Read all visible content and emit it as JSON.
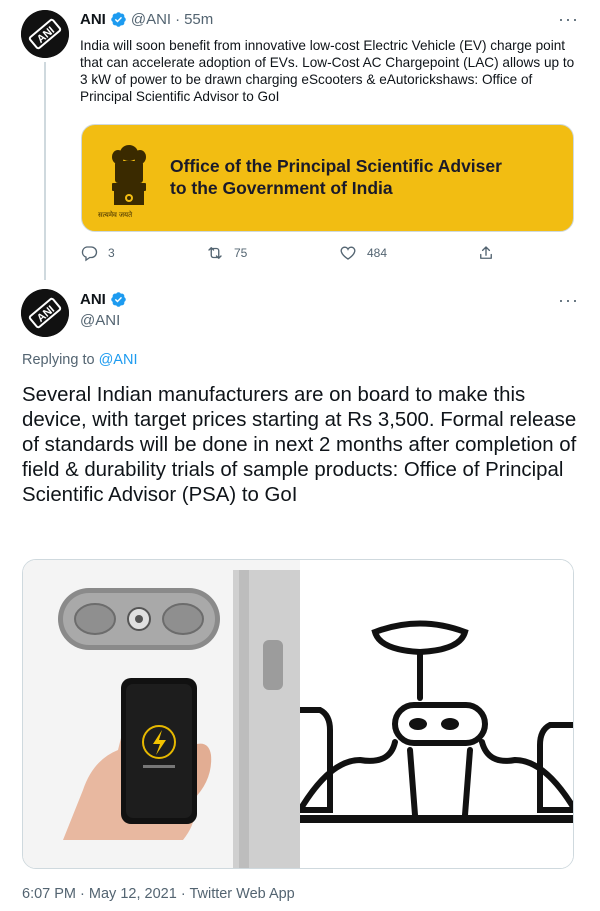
{
  "colors": {
    "accent": "#1d9bf0",
    "text_primary": "#0f1419",
    "text_secondary": "#536471",
    "card_background": "#f2bd12",
    "border": "#cfd9de"
  },
  "tweet1": {
    "author_name": "ANI",
    "handle": "@ANI",
    "separator": "·",
    "time": "55m",
    "text": "India will soon benefit from innovative low-cost Electric Vehicle (EV) charge point that can accelerate adoption of EVs. Low-Cost AC Chargepoint (LAC) allows up to 3 kW of power to be drawn charging eScooters & eAutorickshaws: Office of Principal Scientific Advisor to GoI",
    "card": {
      "title_line1": "Office of the Principal Scientific Adviser",
      "title_line2": "to the Government of India",
      "emblem_caption": "सत्यमेव जयते"
    },
    "actions": {
      "replies": "3",
      "retweets": "75",
      "likes": "484"
    },
    "icons": [
      "verified-badge-icon",
      "more-icon",
      "reply-icon",
      "retweet-icon",
      "like-icon",
      "share-icon"
    ]
  },
  "tweet2": {
    "author_name": "ANI",
    "handle": "@ANI",
    "replying_prefix": "Replying to",
    "replying_handle": "@ANI",
    "text": "Several Indian manufacturers are on board to make this device, with target prices starting at Rs 3,500. Formal release of standards will be done in next 2 months after completion of field & durability trials of sample products: Office of Principal Scientific Advisor (PSA) to GoI",
    "footer": {
      "time": "6:07 PM",
      "separator1": "·",
      "date": "May 12, 2021",
      "separator2": "·",
      "source": "Twitter Web App"
    }
  }
}
